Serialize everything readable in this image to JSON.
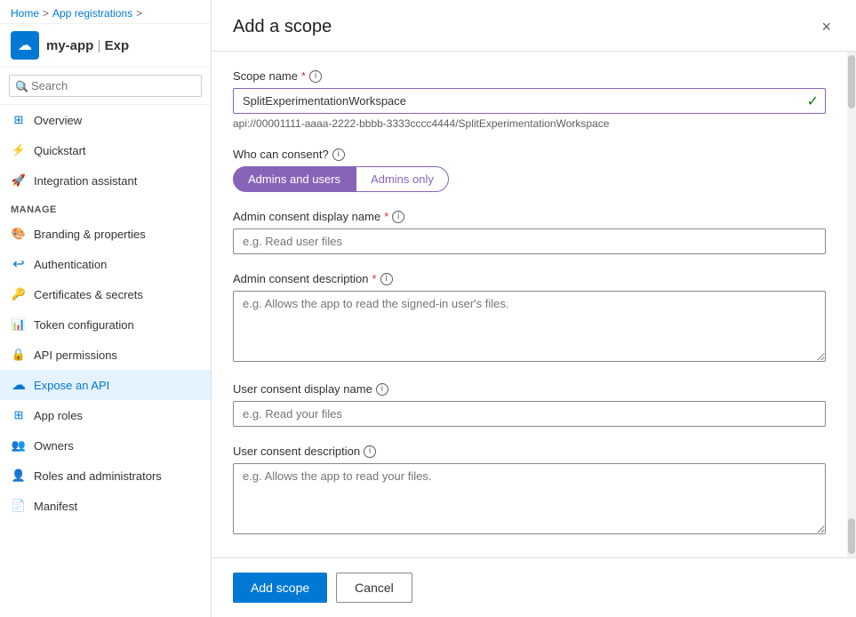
{
  "breadcrumb": {
    "home": "Home",
    "app_registrations": "App registrations",
    "sep1": ">",
    "sep2": ">"
  },
  "app": {
    "name": "my-app",
    "pipe": "|",
    "subtitle": "Exp"
  },
  "search": {
    "placeholder": "Search"
  },
  "nav": {
    "overview": "Overview",
    "quickstart": "Quickstart",
    "integration_assistant": "Integration assistant",
    "manage_label": "Manage",
    "branding": "Branding & properties",
    "authentication": "Authentication",
    "certificates": "Certificates & secrets",
    "token_config": "Token configuration",
    "api_permissions": "API permissions",
    "expose_api": "Expose an API",
    "app_roles": "App roles",
    "owners": "Owners",
    "roles_admins": "Roles and administrators",
    "manifest": "Manifest"
  },
  "panel": {
    "title": "Add a scope",
    "close_icon": "×",
    "scope_name_label": "Scope name",
    "scope_name_value": "SplitExperimentationWorkspace",
    "api_url": "api://00001111-aaaa-2222-bbbb-3333cccc4444/SplitExperimentationWorkspace",
    "who_can_consent_label": "Who can consent?",
    "consent_admins_users": "Admins and users",
    "consent_admins_only": "Admins only",
    "admin_consent_display_label": "Admin consent display name",
    "admin_consent_display_placeholder": "e.g. Read user files",
    "admin_consent_desc_label": "Admin consent description",
    "admin_consent_desc_placeholder": "e.g. Allows the app to read the signed-in user's files.",
    "user_consent_display_label": "User consent display name",
    "user_consent_display_placeholder": "e.g. Read your files",
    "user_consent_desc_label": "User consent description",
    "user_consent_desc_placeholder": "e.g. Allows the app to read your files.",
    "add_scope_btn": "Add scope",
    "cancel_btn": "Cancel"
  }
}
